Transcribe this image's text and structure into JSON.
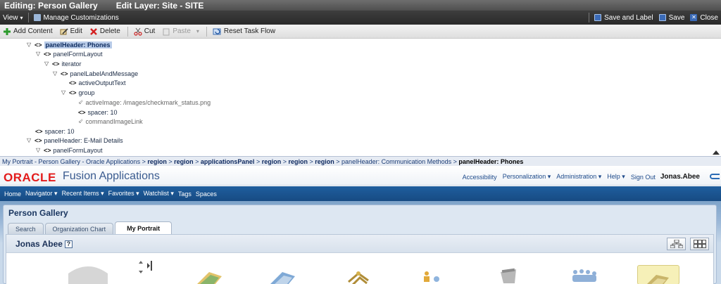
{
  "titlebar": {
    "editing": "Editing: Person Gallery",
    "layer": "Edit Layer: Site - SITE"
  },
  "menubar": {
    "view": "View",
    "manage": "Manage Customizations",
    "save_and_label": "Save and Label",
    "save": "Save",
    "close": "Close"
  },
  "edittoolbar": {
    "add_content": "Add Content",
    "edit": "Edit",
    "delete": "Delete",
    "cut": "Cut",
    "paste": "Paste",
    "reset": "Reset Task Flow"
  },
  "tree": [
    {
      "label": "panelHeader: Phones",
      "type": "tag"
    },
    {
      "label": "panelFormLayout",
      "type": "tag"
    },
    {
      "label": "iterator",
      "type": "tag"
    },
    {
      "label": "panelLabelAndMessage",
      "type": "tag"
    },
    {
      "label": "activeOutputText",
      "type": "tag"
    },
    {
      "label": "group",
      "type": "tag"
    },
    {
      "label": "activeImage: /images/checkmark_status.png",
      "type": "disabled"
    },
    {
      "label": "spacer: 10",
      "type": "tag"
    },
    {
      "label": "commandImageLink",
      "type": "disabled"
    },
    {
      "label": "spacer: 10",
      "type": "tag"
    },
    {
      "label": "panelHeader: E-Mail Details",
      "type": "tag"
    },
    {
      "label": "panelFormLayout",
      "type": "tag"
    }
  ],
  "breadcrumb": {
    "items": [
      "My Portrait - Person Gallery - Oracle Applications",
      "region",
      "region",
      "applicationsPanel",
      "region",
      "region",
      "region",
      "panelHeader: Communication Methods"
    ],
    "current": "panelHeader: Phones"
  },
  "oracle": {
    "logo": "ORACLE",
    "app": "Fusion Applications",
    "links": [
      "Accessibility",
      "Personalization ▾",
      "Administration ▾",
      "Help ▾",
      "Sign Out"
    ],
    "user": "Jonas.Abee"
  },
  "nav": {
    "items": [
      "Home",
      "Navigator ▾",
      "Recent Items ▾",
      "Favorites ▾",
      "Watchlist ▾",
      "Tags",
      "Spaces"
    ]
  },
  "page": {
    "title": "Person Gallery",
    "tabs": [
      "Search",
      "Organization Chart",
      "My Portrait"
    ],
    "active_tab": "My Portrait",
    "person": "Jonas Abee",
    "help": "?"
  },
  "colors": {
    "oracle_red": "#e31b1b",
    "nav_blue": "#1f5e9e",
    "selection": "#b8cbe8"
  }
}
